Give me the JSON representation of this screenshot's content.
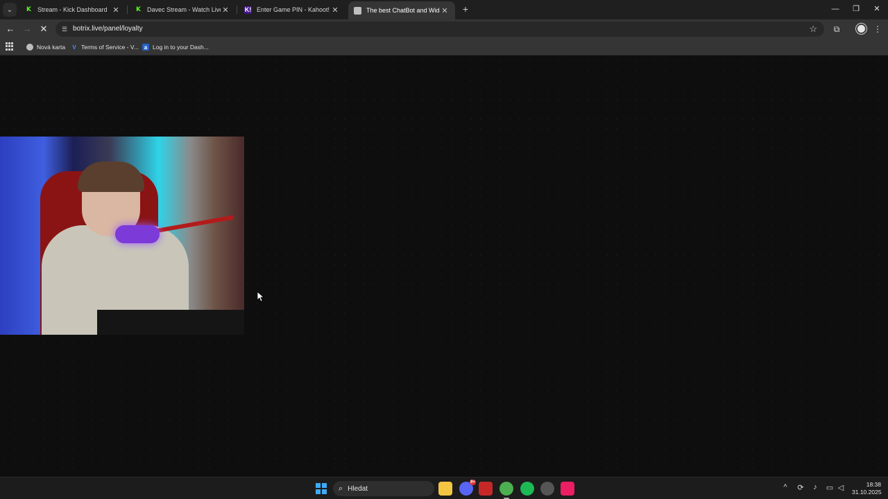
{
  "browser": {
    "tabs": [
      {
        "title": "Stream - Kick Dashboard",
        "favicon": "kick-icon",
        "active": false
      },
      {
        "title": "Davec Stream - Watch Live on Kick",
        "favicon": "kick-icon",
        "active": false
      },
      {
        "title": "Enter Game PIN - Kahoot!",
        "favicon": "kahoot-icon",
        "active": false
      },
      {
        "title": "The best ChatBot and Widgets",
        "favicon": "loading-globe-icon",
        "active": true
      }
    ],
    "new_tab_glyph": "+",
    "address": {
      "url": "botrix.live/panel/loyalty"
    },
    "bookmarks": [
      {
        "label": "Nová karta",
        "icon": "globe-icon"
      },
      {
        "label": "Terms of Service - V...",
        "icon": "v-icon"
      },
      {
        "label": "Log in to your Dash...",
        "icon": "a-icon"
      }
    ]
  },
  "taskbar": {
    "search_label": "Hledat",
    "apps": [
      {
        "name": "file-explorer",
        "color": "#f4c542"
      },
      {
        "name": "discord",
        "color": "#5865f2",
        "badge": "9+"
      },
      {
        "name": "snipping-tool",
        "color": "#c62828"
      },
      {
        "name": "chrome",
        "color": "#4caf50"
      },
      {
        "name": "spotify",
        "color": "#1db954"
      },
      {
        "name": "steam-like",
        "color": "#555555"
      },
      {
        "name": "tiktok",
        "color": "#e91e63"
      }
    ],
    "clock": {
      "time": "18:38",
      "date": "31.10.2025"
    }
  },
  "colors": {
    "page_background": "#0e0e0e",
    "active_tab": "#353535",
    "kick_green": "#53fc18",
    "windows_blue": "#3fa9f5"
  }
}
